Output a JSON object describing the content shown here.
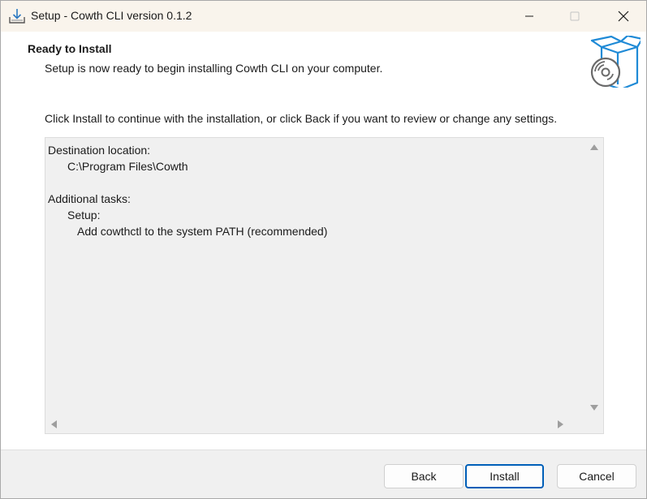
{
  "window": {
    "title": "Setup - Cowth CLI version 0.1.2"
  },
  "header": {
    "title": "Ready to Install",
    "subtitle": "Setup is now ready to begin installing Cowth CLI on your computer."
  },
  "instructions": "Click Install to continue with the installation, or click Back if you want to review or change any settings.",
  "memo": {
    "lines": [
      {
        "text": "Destination location:",
        "indent": 0
      },
      {
        "text": "C:\\Program Files\\Cowth",
        "indent": 1
      },
      {
        "text": "",
        "indent": 0
      },
      {
        "text": "Additional tasks:",
        "indent": 0
      },
      {
        "text": "Setup:",
        "indent": 1
      },
      {
        "text": "Add cowthctl to the system PATH (recommended)",
        "indent": 2
      }
    ]
  },
  "buttons": {
    "back": "Back",
    "install": "Install",
    "cancel": "Cancel"
  },
  "icons": {
    "app": "setup-installer-icon",
    "header": "box-with-disc-icon",
    "minimize": "minimize-icon",
    "maximize": "maximize-icon",
    "close": "close-icon"
  },
  "colors": {
    "titlebar_bg": "#f9f4ec",
    "accent": "#005fb8",
    "memo_bg": "#f0f0f0",
    "footer_bg": "#f0f0f0"
  }
}
